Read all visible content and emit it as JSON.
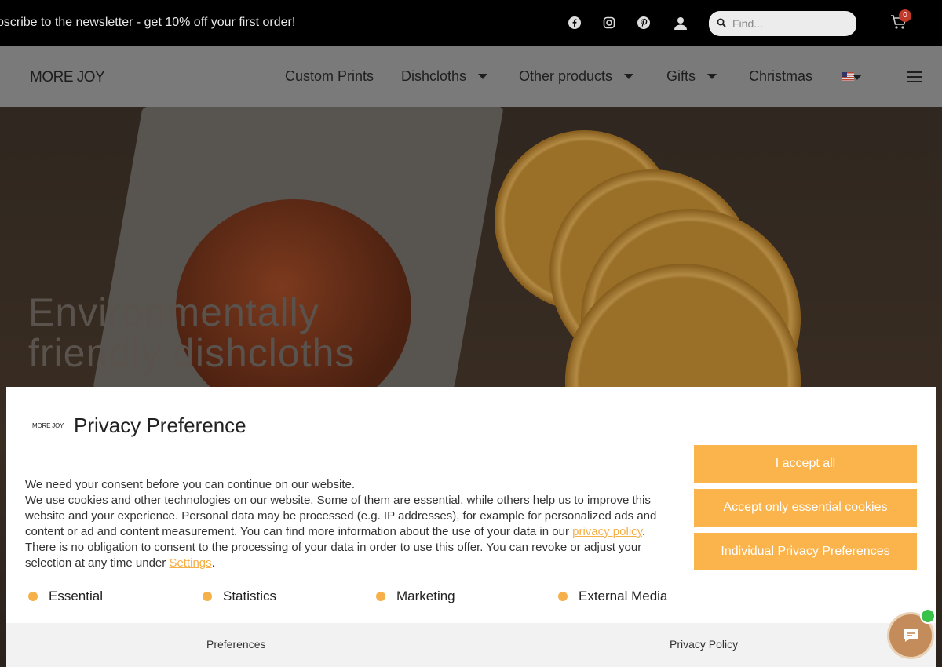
{
  "topbar": {
    "promo_text": "bscribe to the newsletter - get 10% off your first order!",
    "social_icons": [
      "facebook-icon",
      "instagram-icon",
      "pinterest-icon"
    ],
    "account_icon": "user-icon",
    "search": {
      "placeholder": "Find..."
    },
    "cart": {
      "count": "0"
    }
  },
  "nav": {
    "logo": "MORE JOY",
    "items": [
      {
        "label": "Custom Prints"
      },
      {
        "label": "Dishcloths"
      },
      {
        "label": "Other products"
      },
      {
        "label": "Gifts"
      },
      {
        "label": "Christmas"
      }
    ]
  },
  "hero": {
    "title_line1": "Environmentally",
    "title_line2": "friendly dishcloths"
  },
  "privacy": {
    "logo": "MORE JOY",
    "title": "Privacy Preference",
    "intro": "We need your consent before you can continue on our website.",
    "body_part1": "We use cookies and other technologies on our website. Some of them are essential, while others help us to improve this website and your experience. Personal data may be processed (e.g. IP addresses), for example for personalized ads and content or ad and content measurement. You can find more information about the use of your data in our ",
    "privacy_link": "privacy policy",
    "body_part2": ". There is no obligation to consent to the processing of your data in order to use this offer. You can revoke or adjust your selection at any time under ",
    "settings_link": "Settings",
    "body_part3": ".",
    "categories": [
      "Essential",
      "Statistics",
      "Marketing",
      "External Media"
    ],
    "buttons": {
      "accept_all": "I accept all",
      "accept_essential": "Accept only essential cookies",
      "individual": "Individual Privacy Preferences"
    },
    "footer": {
      "preferences": "Preferences",
      "privacy_policy": "Privacy Policy"
    },
    "accent_color": "#fbb34c"
  }
}
